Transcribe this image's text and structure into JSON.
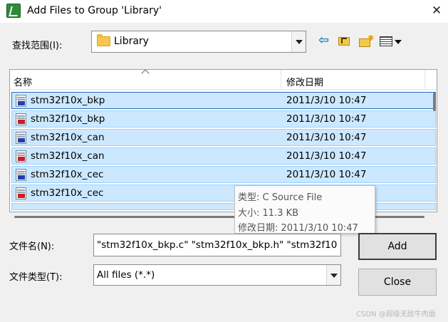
{
  "window": {
    "title": "Add Files to Group 'Library'",
    "close_glyph": "✕"
  },
  "lookin": {
    "label": "查找范围(I):",
    "value": "Library"
  },
  "toolbar": {
    "icons": [
      "back-arrow-icon",
      "up-folder-icon",
      "new-folder-icon",
      "view-menu-icon"
    ]
  },
  "columns": {
    "name": "名称",
    "modified": "修改日期"
  },
  "files": [
    {
      "name": "stm32f10x_bkp",
      "type": "c",
      "date": "2011/3/10 10:47"
    },
    {
      "name": "stm32f10x_bkp",
      "type": "h",
      "date": "2011/3/10 10:47"
    },
    {
      "name": "stm32f10x_can",
      "type": "c",
      "date": "2011/3/10 10:47"
    },
    {
      "name": "stm32f10x_can",
      "type": "h",
      "date": "2011/3/10 10:47"
    },
    {
      "name": "stm32f10x_cec",
      "type": "c",
      "date": "2011/3/10 10:47"
    },
    {
      "name": "stm32f10x_cec",
      "type": "h",
      "date": ""
    }
  ],
  "tooltip": {
    "type_line": "类型: C Source File",
    "size_line": "大小: 11.3 KB",
    "date_line": "修改日期: 2011/3/10 10:47"
  },
  "filename": {
    "label": "文件名(N):",
    "value": "\"stm32f10x_bkp.c\" \"stm32f10x_bkp.h\" \"stm32f10"
  },
  "filetype": {
    "label": "文件类型(T):",
    "value": "All files (*.*)"
  },
  "buttons": {
    "add": "Add",
    "close": "Close"
  },
  "watermark": "CSDN @超级无敌牛肉面"
}
